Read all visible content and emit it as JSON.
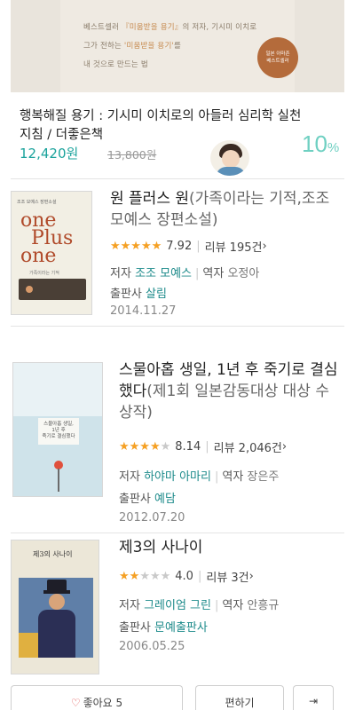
{
  "promo": {
    "line1_prefix": "베스트셀러 ",
    "line1_highlight": "『미움받을 용기』",
    "line1_suffix": "의 저자, 기시미 이치로",
    "line2_prefix": "그가 전하는 ",
    "line2_highlight": "'미움받을 용기'",
    "line2_suffix": "를",
    "line3": "내 것으로 만드는 법",
    "seal_line1": "일본 아마존",
    "seal_line2": "베스트셀러"
  },
  "deal": {
    "title": "행복해질 용기 : 기시미 이치로의 아들러 심리학 실천 지침 / 더좋은책",
    "price": "12,420원",
    "original_price": "13,800원",
    "discount_value": "10",
    "discount_unit": "%"
  },
  "books": [
    {
      "title_main": "원 플러스 원",
      "title_sub": "(가족이라는 기적,조조 모예스 장편소설)",
      "stars_on": "★★★★★",
      "stars_off": "",
      "score": "7.92",
      "reviews": "리뷰 195건",
      "author_label": "저자",
      "author": "조조 모예스",
      "translator_label": "역자",
      "translator": "오정아",
      "publisher_label": "출판사",
      "publisher": "살림",
      "date": "2014.11.27",
      "cover": {
        "line1": "조조 모예스 장편소설",
        "line2": "one",
        "line3": "Plus",
        "line4": "one",
        "line5": "가족이라는 기적"
      }
    },
    {
      "title_main": "스물아홉 생일, 1년 후 죽기로 결심했다",
      "title_sub": "(제1회 일본감동대상 대상 수상작)",
      "stars_on": "★★★★",
      "stars_off": "★",
      "score": "8.14",
      "reviews": "리뷰 2,046건",
      "author_label": "저자",
      "author": "하야마 아마리",
      "translator_label": "역자",
      "translator": "장은주",
      "publisher_label": "출판사",
      "publisher": "예담",
      "date": "2012.07.20",
      "cover": {
        "line1": "스물아홉 생일,",
        "line2": "1년 후",
        "line3": "죽기로 결심했다"
      }
    },
    {
      "title_main": "제3의 사나이",
      "title_sub": "",
      "stars_on": "★★",
      "stars_off": "★★★",
      "score": "4.0",
      "reviews": "리뷰 3건",
      "author_label": "저자",
      "author": "그레이엄 그린",
      "translator_label": "역자",
      "translator": "안흥규",
      "publisher_label": "출판사",
      "publisher": "문예출판사",
      "date": "2006.05.25",
      "cover": {
        "line1": "제3의 사나이"
      }
    }
  ],
  "actions": {
    "wish_label": "좋아요 5",
    "edit_label": "편하기"
  },
  "colors": {
    "accent": "#1c8a8a",
    "price": "#1ba39c",
    "star": "#f5a023"
  }
}
